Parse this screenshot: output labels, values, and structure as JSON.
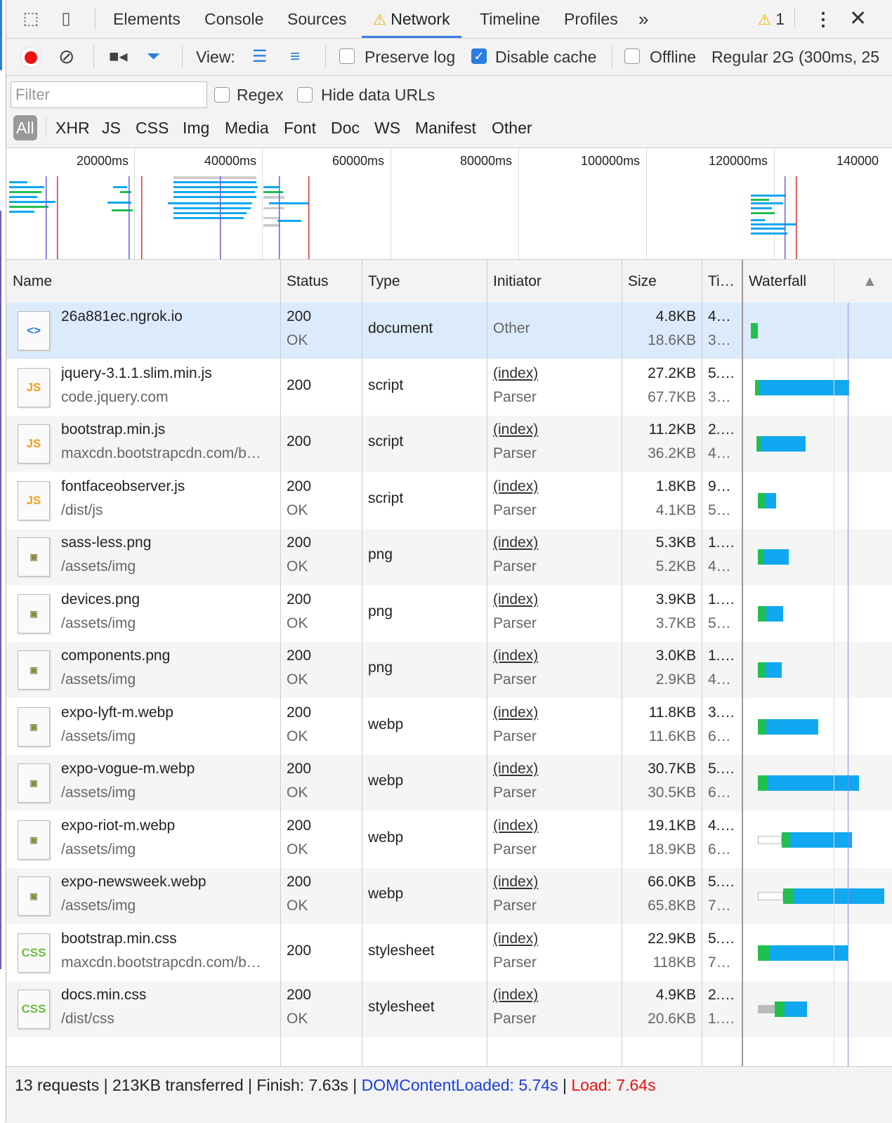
{
  "tabs": {
    "items": [
      "Elements",
      "Console",
      "Sources",
      "Network",
      "Timeline",
      "Profiles"
    ],
    "more": "»",
    "warning_count": "1"
  },
  "toolbar": {
    "view_label": "View:",
    "preserve_log": "Preserve log",
    "disable_cache": "Disable cache",
    "offline": "Offline",
    "throttle": "Regular 2G (300ms, 25"
  },
  "filter": {
    "placeholder": "Filter",
    "regex": "Regex",
    "hide_data_urls": "Hide data URLs",
    "types": [
      "All",
      "XHR",
      "JS",
      "CSS",
      "Img",
      "Media",
      "Font",
      "Doc",
      "WS",
      "Manifest",
      "Other"
    ]
  },
  "overview": {
    "ticks": [
      "20000ms",
      "40000ms",
      "60000ms",
      "80000ms",
      "100000ms",
      "120000ms",
      "140000"
    ]
  },
  "columns": {
    "name": "Name",
    "status": "Status",
    "type": "Type",
    "initiator": "Initiator",
    "size": "Size",
    "time": "Ti…",
    "waterfall": "Waterfall"
  },
  "requests": [
    {
      "name": "26a881ec.ngrok.io",
      "path": "",
      "status": "200",
      "status_text": "OK",
      "type": "document",
      "initiator": "Other",
      "initiator_sub": "",
      "size": "4.8KB",
      "content": "18.6KB",
      "time": "4…",
      "latency": "3…",
      "icon": "doc"
    },
    {
      "name": "jquery-3.1.1.slim.min.js",
      "path": "code.jquery.com",
      "status": "200",
      "status_text": "",
      "type": "script",
      "initiator": "(index)",
      "initiator_sub": "Parser",
      "size": "27.2KB",
      "content": "67.7KB",
      "time": "5.…",
      "latency": "3…",
      "icon": "js"
    },
    {
      "name": "bootstrap.min.js",
      "path": "maxcdn.bootstrapcdn.com/b…",
      "status": "200",
      "status_text": "",
      "type": "script",
      "initiator": "(index)",
      "initiator_sub": "Parser",
      "size": "11.2KB",
      "content": "36.2KB",
      "time": "2.…",
      "latency": "4…",
      "icon": "js"
    },
    {
      "name": "fontfaceobserver.js",
      "path": "/dist/js",
      "status": "200",
      "status_text": "OK",
      "type": "script",
      "initiator": "(index)",
      "initiator_sub": "Parser",
      "size": "1.8KB",
      "content": "4.1KB",
      "time": "9…",
      "latency": "5…",
      "icon": "js"
    },
    {
      "name": "sass-less.png",
      "path": "/assets/img",
      "status": "200",
      "status_text": "OK",
      "type": "png",
      "initiator": "(index)",
      "initiator_sub": "Parser",
      "size": "5.3KB",
      "content": "5.2KB",
      "time": "1.…",
      "latency": "4…",
      "icon": "img"
    },
    {
      "name": "devices.png",
      "path": "/assets/img",
      "status": "200",
      "status_text": "OK",
      "type": "png",
      "initiator": "(index)",
      "initiator_sub": "Parser",
      "size": "3.9KB",
      "content": "3.7KB",
      "time": "1.…",
      "latency": "5…",
      "icon": "img"
    },
    {
      "name": "components.png",
      "path": "/assets/img",
      "status": "200",
      "status_text": "OK",
      "type": "png",
      "initiator": "(index)",
      "initiator_sub": "Parser",
      "size": "3.0KB",
      "content": "2.9KB",
      "time": "1.…",
      "latency": "4…",
      "icon": "img"
    },
    {
      "name": "expo-lyft-m.webp",
      "path": "/assets/img",
      "status": "200",
      "status_text": "OK",
      "type": "webp",
      "initiator": "(index)",
      "initiator_sub": "Parser",
      "size": "11.8KB",
      "content": "11.6KB",
      "time": "3.…",
      "latency": "6…",
      "icon": "img"
    },
    {
      "name": "expo-vogue-m.webp",
      "path": "/assets/img",
      "status": "200",
      "status_text": "OK",
      "type": "webp",
      "initiator": "(index)",
      "initiator_sub": "Parser",
      "size": "30.7KB",
      "content": "30.5KB",
      "time": "5.…",
      "latency": "6…",
      "icon": "img"
    },
    {
      "name": "expo-riot-m.webp",
      "path": "/assets/img",
      "status": "200",
      "status_text": "OK",
      "type": "webp",
      "initiator": "(index)",
      "initiator_sub": "Parser",
      "size": "19.1KB",
      "content": "18.9KB",
      "time": "4.…",
      "latency": "6…",
      "icon": "img"
    },
    {
      "name": "expo-newsweek.webp",
      "path": "/assets/img",
      "status": "200",
      "status_text": "OK",
      "type": "webp",
      "initiator": "(index)",
      "initiator_sub": "Parser",
      "size": "66.0KB",
      "content": "65.8KB",
      "time": "5.…",
      "latency": "7…",
      "icon": "img"
    },
    {
      "name": "bootstrap.min.css",
      "path": "maxcdn.bootstrapcdn.com/b…",
      "status": "200",
      "status_text": "",
      "type": "stylesheet",
      "initiator": "(index)",
      "initiator_sub": "Parser",
      "size": "22.9KB",
      "content": "118KB",
      "time": "5.…",
      "latency": "7…",
      "icon": "css"
    },
    {
      "name": "docs.min.css",
      "path": "/dist/css",
      "status": "200",
      "status_text": "OK",
      "type": "stylesheet",
      "initiator": "(index)",
      "initiator_sub": "Parser",
      "size": "4.9KB",
      "content": "20.6KB",
      "time": "2.…",
      "latency": "1.…",
      "icon": "css"
    }
  ],
  "footer": {
    "requests": "13 requests",
    "transferred": "213KB transferred",
    "finish": "Finish: 7.63s",
    "dcl": "DOMContentLoaded: 5.74s",
    "load": "Load: 7.64s"
  },
  "colors": {
    "accent": "#2a7de1",
    "dcl": "#1a3ee0",
    "load": "#e11111",
    "waiting": "#20c050",
    "download": "#10a8f0"
  }
}
